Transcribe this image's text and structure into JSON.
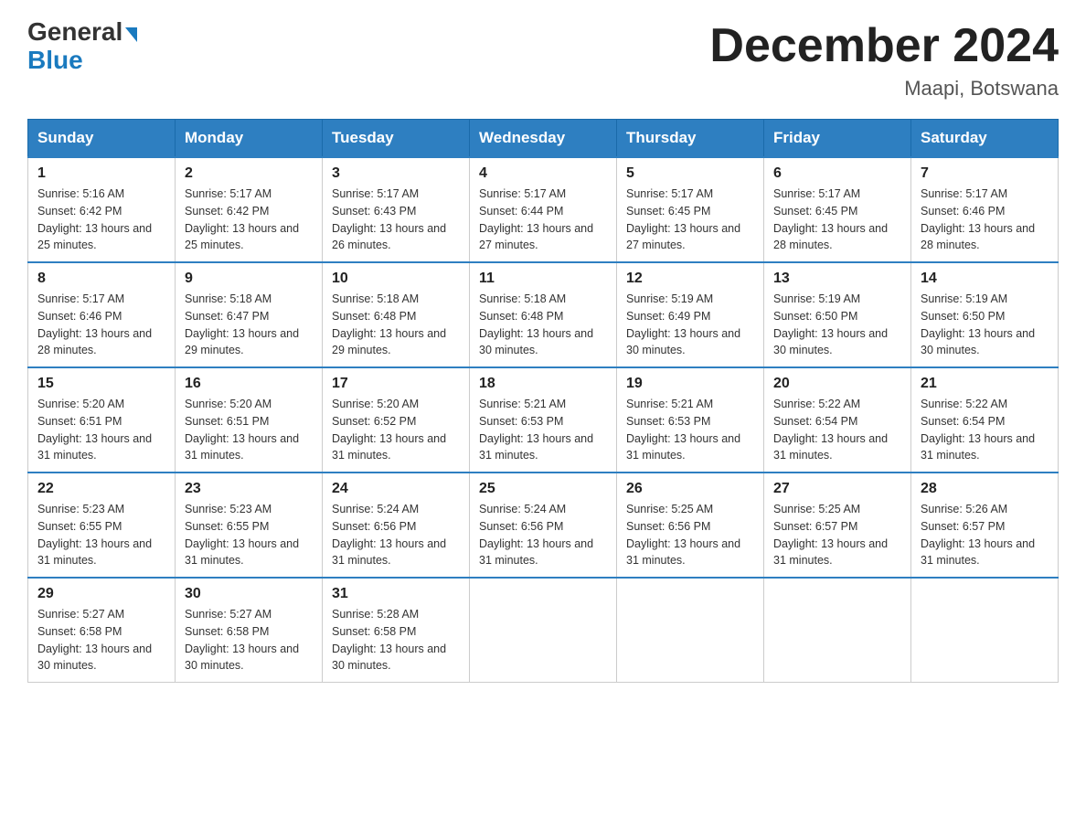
{
  "header": {
    "logo_line1": "General",
    "logo_line2": "Blue",
    "title": "December 2024",
    "subtitle": "Maapi, Botswana"
  },
  "days_of_week": [
    "Sunday",
    "Monday",
    "Tuesday",
    "Wednesday",
    "Thursday",
    "Friday",
    "Saturday"
  ],
  "weeks": [
    [
      {
        "day": "1",
        "sunrise": "5:16 AM",
        "sunset": "6:42 PM",
        "daylight": "13 hours and 25 minutes."
      },
      {
        "day": "2",
        "sunrise": "5:17 AM",
        "sunset": "6:42 PM",
        "daylight": "13 hours and 25 minutes."
      },
      {
        "day": "3",
        "sunrise": "5:17 AM",
        "sunset": "6:43 PM",
        "daylight": "13 hours and 26 minutes."
      },
      {
        "day": "4",
        "sunrise": "5:17 AM",
        "sunset": "6:44 PM",
        "daylight": "13 hours and 27 minutes."
      },
      {
        "day": "5",
        "sunrise": "5:17 AM",
        "sunset": "6:45 PM",
        "daylight": "13 hours and 27 minutes."
      },
      {
        "day": "6",
        "sunrise": "5:17 AM",
        "sunset": "6:45 PM",
        "daylight": "13 hours and 28 minutes."
      },
      {
        "day": "7",
        "sunrise": "5:17 AM",
        "sunset": "6:46 PM",
        "daylight": "13 hours and 28 minutes."
      }
    ],
    [
      {
        "day": "8",
        "sunrise": "5:17 AM",
        "sunset": "6:46 PM",
        "daylight": "13 hours and 28 minutes."
      },
      {
        "day": "9",
        "sunrise": "5:18 AM",
        "sunset": "6:47 PM",
        "daylight": "13 hours and 29 minutes."
      },
      {
        "day": "10",
        "sunrise": "5:18 AM",
        "sunset": "6:48 PM",
        "daylight": "13 hours and 29 minutes."
      },
      {
        "day": "11",
        "sunrise": "5:18 AM",
        "sunset": "6:48 PM",
        "daylight": "13 hours and 30 minutes."
      },
      {
        "day": "12",
        "sunrise": "5:19 AM",
        "sunset": "6:49 PM",
        "daylight": "13 hours and 30 minutes."
      },
      {
        "day": "13",
        "sunrise": "5:19 AM",
        "sunset": "6:50 PM",
        "daylight": "13 hours and 30 minutes."
      },
      {
        "day": "14",
        "sunrise": "5:19 AM",
        "sunset": "6:50 PM",
        "daylight": "13 hours and 30 minutes."
      }
    ],
    [
      {
        "day": "15",
        "sunrise": "5:20 AM",
        "sunset": "6:51 PM",
        "daylight": "13 hours and 31 minutes."
      },
      {
        "day": "16",
        "sunrise": "5:20 AM",
        "sunset": "6:51 PM",
        "daylight": "13 hours and 31 minutes."
      },
      {
        "day": "17",
        "sunrise": "5:20 AM",
        "sunset": "6:52 PM",
        "daylight": "13 hours and 31 minutes."
      },
      {
        "day": "18",
        "sunrise": "5:21 AM",
        "sunset": "6:53 PM",
        "daylight": "13 hours and 31 minutes."
      },
      {
        "day": "19",
        "sunrise": "5:21 AM",
        "sunset": "6:53 PM",
        "daylight": "13 hours and 31 minutes."
      },
      {
        "day": "20",
        "sunrise": "5:22 AM",
        "sunset": "6:54 PM",
        "daylight": "13 hours and 31 minutes."
      },
      {
        "day": "21",
        "sunrise": "5:22 AM",
        "sunset": "6:54 PM",
        "daylight": "13 hours and 31 minutes."
      }
    ],
    [
      {
        "day": "22",
        "sunrise": "5:23 AM",
        "sunset": "6:55 PM",
        "daylight": "13 hours and 31 minutes."
      },
      {
        "day": "23",
        "sunrise": "5:23 AM",
        "sunset": "6:55 PM",
        "daylight": "13 hours and 31 minutes."
      },
      {
        "day": "24",
        "sunrise": "5:24 AM",
        "sunset": "6:56 PM",
        "daylight": "13 hours and 31 minutes."
      },
      {
        "day": "25",
        "sunrise": "5:24 AM",
        "sunset": "6:56 PM",
        "daylight": "13 hours and 31 minutes."
      },
      {
        "day": "26",
        "sunrise": "5:25 AM",
        "sunset": "6:56 PM",
        "daylight": "13 hours and 31 minutes."
      },
      {
        "day": "27",
        "sunrise": "5:25 AM",
        "sunset": "6:57 PM",
        "daylight": "13 hours and 31 minutes."
      },
      {
        "day": "28",
        "sunrise": "5:26 AM",
        "sunset": "6:57 PM",
        "daylight": "13 hours and 31 minutes."
      }
    ],
    [
      {
        "day": "29",
        "sunrise": "5:27 AM",
        "sunset": "6:58 PM",
        "daylight": "13 hours and 30 minutes."
      },
      {
        "day": "30",
        "sunrise": "5:27 AM",
        "sunset": "6:58 PM",
        "daylight": "13 hours and 30 minutes."
      },
      {
        "day": "31",
        "sunrise": "5:28 AM",
        "sunset": "6:58 PM",
        "daylight": "13 hours and 30 minutes."
      },
      null,
      null,
      null,
      null
    ]
  ]
}
